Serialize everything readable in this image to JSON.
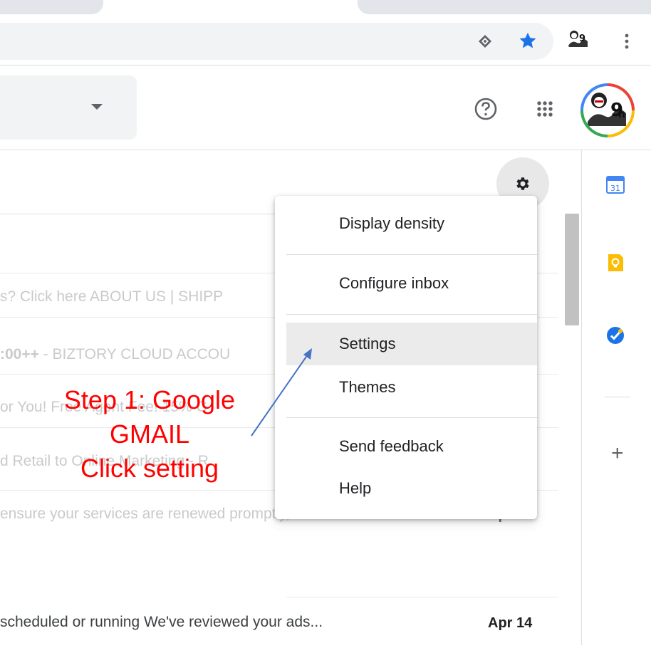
{
  "browser": {
    "extension_icon": "extension-diamond-icon",
    "bookmark_icon": "star-icon",
    "bookmark_color": "#1a73e8",
    "menu_icon": "kebab-menu-icon"
  },
  "header": {
    "help_icon": "help-circle-icon",
    "apps_icon": "apps-grid-icon"
  },
  "toolbar": {
    "settings_icon": "gear-icon"
  },
  "mail_rows": [
    {
      "snippet": "s? Click here ABOUT US | SHIPP",
      "bold": ""
    },
    {
      "snippet": " - BIZTORY CLOUD ACCOU",
      "bold": ":00++"
    },
    {
      "snippet": "or You! Free Agent Fee! 15% C",
      "bold": ""
    },
    {
      "snippet": "d Retail to Online Marketing - R",
      "bold": ""
    },
    {
      "snippet": "ensure your services are renewed promptly, We...",
      "bold": "",
      "date": "Apr 15"
    },
    {
      "snippet": "scheduled or running We've reviewed your ads...",
      "bold": "",
      "date": "Apr 14"
    }
  ],
  "settings_menu": {
    "items": [
      {
        "label": "Display density"
      },
      {
        "label": "Configure inbox"
      },
      {
        "label": "Settings"
      },
      {
        "label": "Themes"
      },
      {
        "label": "Send feedback"
      },
      {
        "label": "Help"
      }
    ]
  },
  "side_panel": {
    "calendar_day": "31",
    "add_label": "+"
  },
  "annotation": {
    "line1": "Step 1: Google",
    "line2": "GMAIL",
    "line3": "Click setting",
    "color": "#ff0000"
  }
}
